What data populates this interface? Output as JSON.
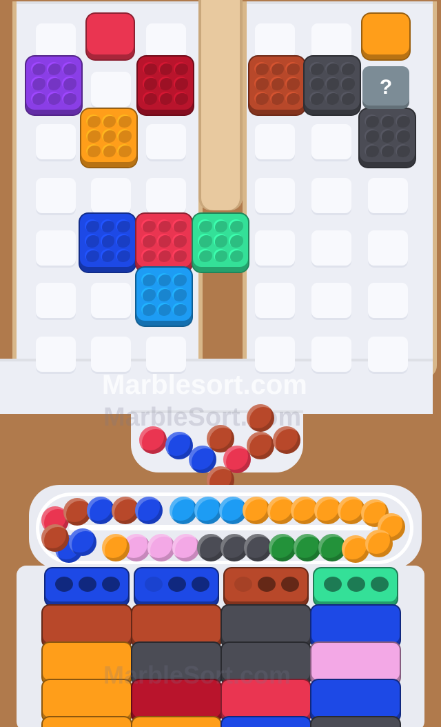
{
  "watermarks": {
    "primary": "Marblesort.com",
    "secondary": "MarbleSort.com",
    "bottom": "MarbleSort.com"
  },
  "colors": {
    "red": "#ea3551",
    "purple": "#8a3ee6",
    "crimson": "#b9142c",
    "orange": "#ff9e1a",
    "brown": "#b8482a",
    "charcoal": "#4b4c55",
    "gray": "#7c8c96",
    "blue": "#1d49e6",
    "green": "#34e098",
    "cyan": "#1d9cf4",
    "pink": "#f3a8e6",
    "darkgreen": "#23923a",
    "board": "#eceef5",
    "wood": "#b07a4c",
    "rim": "#d8b78a"
  },
  "grid": {
    "left": {
      "cols": 3,
      "rows": 7
    },
    "right": {
      "cols": 3,
      "rows": 7
    }
  },
  "blocks": [
    {
      "name": "red-block-flat",
      "color": "red",
      "flat": true
    },
    {
      "name": "purple-block",
      "color": "purple"
    },
    {
      "name": "crimson-block",
      "color": "crimson"
    },
    {
      "name": "orange-block",
      "color": "orange"
    },
    {
      "name": "orange-block-flat",
      "color": "orange",
      "flat": true
    },
    {
      "name": "brown-block",
      "color": "brown"
    },
    {
      "name": "charcoal-block",
      "color": "charcoal"
    },
    {
      "name": "charcoal-block-lower",
      "color": "charcoal"
    },
    {
      "name": "blue-block",
      "color": "blue"
    },
    {
      "name": "red-block",
      "color": "red"
    },
    {
      "name": "green-block",
      "color": "green"
    },
    {
      "name": "cyan-block",
      "color": "cyan"
    }
  ],
  "mystery_block": {
    "label": "?",
    "color": "gray"
  },
  "funnel_marbles": [
    "red",
    "blue",
    "brown",
    "brown",
    "blue",
    "red",
    "brown",
    "brown",
    "brown",
    "blue"
  ],
  "track": {
    "outer": [
      "red",
      "brown",
      "blue",
      "brown",
      "blue",
      "cyan",
      "cyan",
      "cyan",
      "orange",
      "orange",
      "orange",
      "orange",
      "orange",
      "orange",
      "orange"
    ],
    "inner": [
      "blue",
      "brown",
      "blue",
      "pink",
      "pink",
      "pink",
      "charcoal",
      "charcoal",
      "charcoal",
      "darkgreen",
      "darkgreen",
      "darkgreen",
      "orange",
      "orange",
      "orange"
    ]
  },
  "containers": [
    {
      "name": "container-col1",
      "stack": [
        "blue",
        "brown",
        "orange",
        "orange",
        "orange"
      ],
      "holes": 3,
      "filled": 0
    },
    {
      "name": "container-col2",
      "stack": [
        "blue",
        "brown",
        "charcoal",
        "crimson",
        "orange"
      ],
      "holes": 3,
      "filled": 1
    },
    {
      "name": "container-col3",
      "stack": [
        "brown",
        "charcoal",
        "charcoal",
        "red",
        "blue"
      ],
      "holes": 3,
      "filled": 1
    },
    {
      "name": "container-col4",
      "stack": [
        "green",
        "blue",
        "pink",
        "blue",
        "charcoal"
      ],
      "holes": 3,
      "filled": 0
    }
  ]
}
